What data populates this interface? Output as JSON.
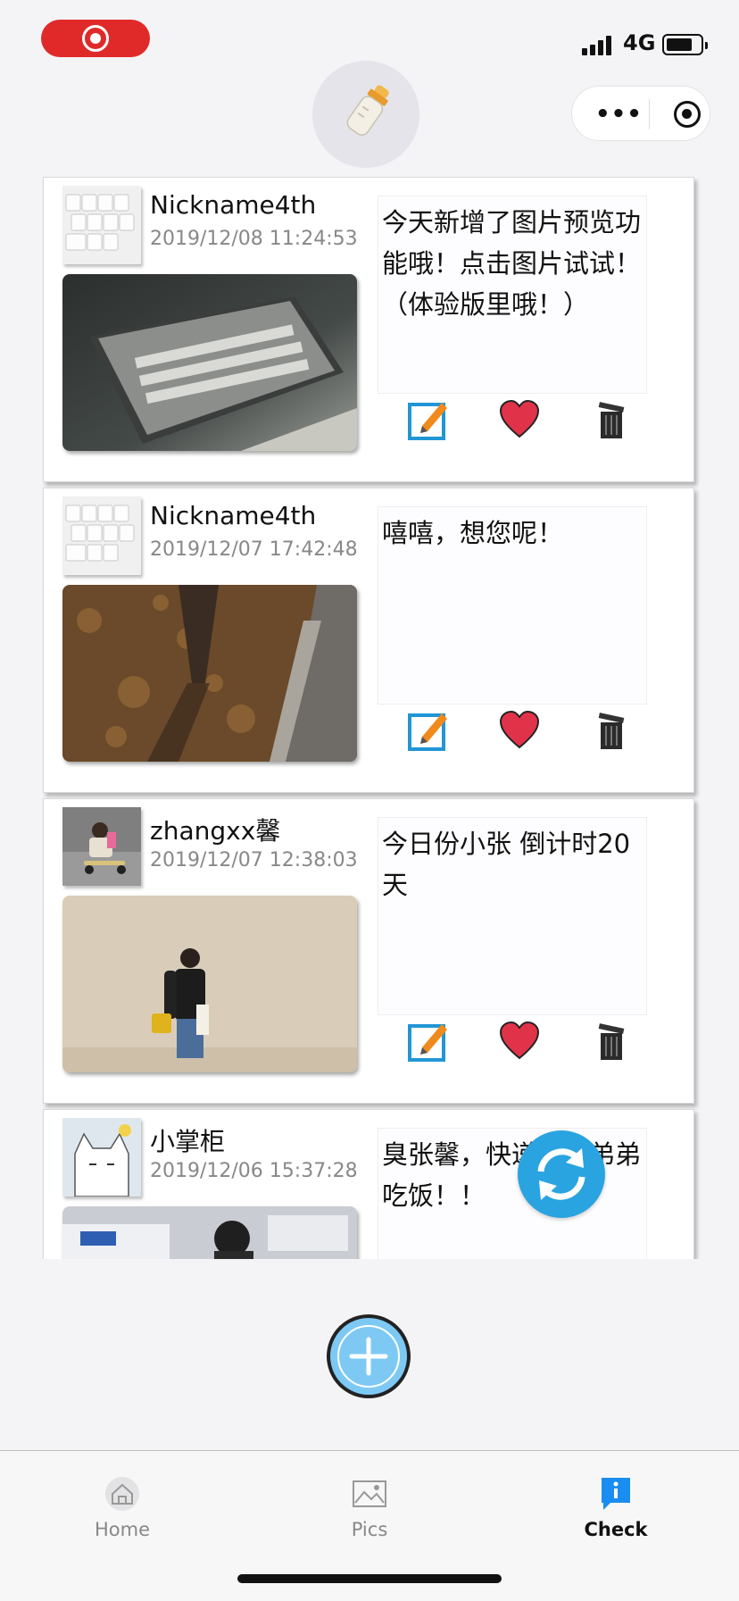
{
  "status_bar": {
    "network": "4G"
  },
  "colors": {
    "accent": "#2aa4e0",
    "record": "#e02a2a",
    "like": "#e0334a",
    "add": "#7ec9f4"
  },
  "posts": [
    {
      "nickname": "Nickname4th",
      "time": "2019/12/08 11:24:53",
      "text": "今天新增了图片预览功能哦！点击图片试试！（体验版里哦！）",
      "photo": "keyboard",
      "avatar": "keyboard"
    },
    {
      "nickname": "Nickname4th",
      "time": "2019/12/07 17:42:48",
      "text": "嘻嘻，想您呢！",
      "photo": "leaves-shadow",
      "avatar": "keyboard"
    },
    {
      "nickname": "zhangxx馨",
      "time": "2019/12/07 12:38:03",
      "text": "今日份小张 倒计时20天",
      "photo": "girl-wall",
      "avatar": "scooter-kid"
    },
    {
      "nickname": "小掌柜",
      "time": "2019/12/06 15:37:28",
      "text": "臭张馨，快递要请弟弟吃饭！！",
      "photo": "classroom",
      "avatar": "cartoon-cat"
    }
  ],
  "actions": {
    "edit_icon": "edit-icon",
    "like_icon": "heart-icon",
    "delete_icon": "trash-icon"
  },
  "tabbar": {
    "items": [
      {
        "label": "Home",
        "icon": "home-icon"
      },
      {
        "label": "Pics",
        "icon": "image-icon"
      },
      {
        "label": "Check",
        "icon": "info-icon"
      }
    ],
    "active": "Check"
  }
}
